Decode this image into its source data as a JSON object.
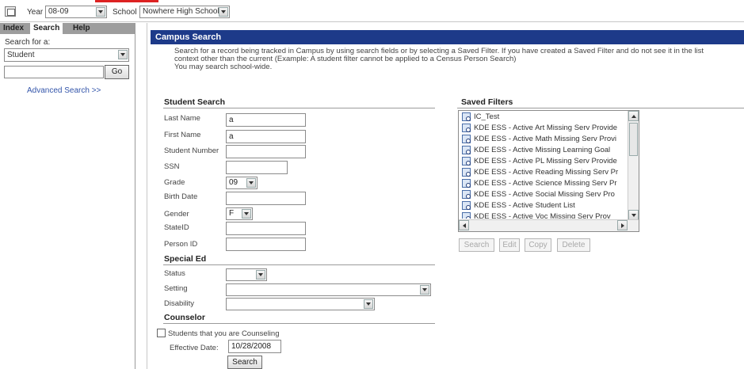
{
  "topbar": {
    "year_label": "Year",
    "year_value": "08-09",
    "school_label": "School",
    "school_value": "Nowhere High School"
  },
  "left_panel": {
    "tabs": [
      {
        "label": "Index"
      },
      {
        "label": "Search"
      },
      {
        "label": "Help"
      }
    ],
    "search_for_label": "Search for a:",
    "search_type_value": "Student",
    "search_input_value": "",
    "go_label": "Go",
    "advanced_search_label": "Advanced Search >>"
  },
  "main": {
    "title": "Campus Search",
    "description_line1": "Search for a record being tracked in Campus by using search fields or by selecting a Saved Filter. If you have created a Saved Filter and do not see it in the list",
    "description_line2": "context other than the current (Example: A student filter cannot be applied to a Census Person Search)",
    "description_line3": "You may search school-wide.",
    "student_search": {
      "title": "Student Search",
      "last_name_label": "Last Name",
      "last_name_value": "a",
      "first_name_label": "First Name",
      "first_name_value": "a",
      "student_number_label": "Student Number",
      "student_number_value": "",
      "ssn_label": "SSN",
      "ssn_value": "",
      "grade_label": "Grade",
      "grade_value": "09",
      "birth_date_label": "Birth Date",
      "birth_date_value": "",
      "gender_label": "Gender",
      "gender_value": "F",
      "stateid_label": "StateID",
      "stateid_value": "",
      "person_id_label": "Person ID",
      "person_id_value": ""
    },
    "special_ed": {
      "title": "Special Ed",
      "status_label": "Status",
      "status_value": "",
      "setting_label": "Setting",
      "setting_value": "",
      "disability_label": "Disability",
      "disability_value": ""
    },
    "counselor": {
      "title": "Counselor",
      "checkbox_label": "Students that you are Counseling",
      "effective_date_label": "Effective Date:",
      "effective_date_value": "10/28/2008",
      "search_button_label": "Search"
    },
    "saved_filters": {
      "title": "Saved Filters",
      "items": [
        "IC_Test",
        "KDE ESS - Active Art Missing Serv Provide",
        "KDE ESS - Active Math Missing Serv Provi",
        "KDE ESS - Active Missing Learning Goal",
        "KDE ESS - Active PL Missing Serv Provide",
        "KDE ESS - Active Reading Missing Serv Pr",
        "KDE ESS - Active Science Missing Serv Pr",
        "KDE ESS - Active Social Missing Serv Pro",
        "KDE ESS - Active Student List",
        "KDE ESS - Active Voc Missing Serv Prov"
      ],
      "search_label": "Search",
      "edit_label": "Edit",
      "copy_label": "Copy",
      "delete_label": "Delete"
    }
  }
}
